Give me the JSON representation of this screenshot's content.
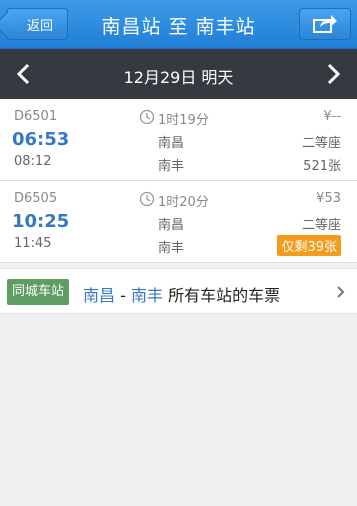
{
  "header": {
    "back_label": "返回",
    "title": "南昌站 至 南丰站"
  },
  "date_bar": {
    "date_label": "12月29日 明天"
  },
  "trains": [
    {
      "number": "D6501",
      "depart_time": "06:53",
      "arrive_time": "08:12",
      "duration": "1时19分",
      "from": "南昌",
      "to": "南丰",
      "price": "¥--",
      "seat_class": "二等座",
      "tickets": "521张"
    },
    {
      "number": "D6505",
      "depart_time": "10:25",
      "arrive_time": "11:45",
      "duration": "1时20分",
      "from": "南昌",
      "to": "南丰",
      "price": "¥53",
      "seat_class": "二等座",
      "tickets": "仅剩39张"
    }
  ],
  "city_stations": {
    "tag": "同城车站",
    "from": "南昌",
    "separator": " - ",
    "to": "南丰",
    "suffix": " 所有车站的车票"
  },
  "colors": {
    "header_blue": "#2a86d6",
    "date_bar": "#343a40",
    "time_blue": "#3678c4",
    "badge_orange": "#f39b1b",
    "tag_green": "#5e9e62"
  }
}
